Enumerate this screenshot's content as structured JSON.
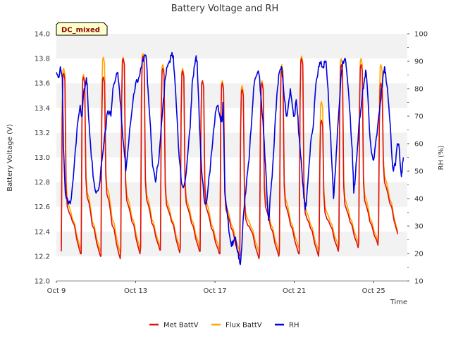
{
  "chart_data": {
    "type": "line",
    "title": "Battery Voltage and RH",
    "badge": "DC_mixed",
    "xlabel": "Time",
    "ylabel_left": "Battery Voltage (V)",
    "ylabel_right": "RH (%)",
    "x_range_days": [
      0,
      17.7
    ],
    "x_ticks": [
      {
        "day": 0,
        "label": "Oct 9"
      },
      {
        "day": 4,
        "label": "Oct 13"
      },
      {
        "day": 8,
        "label": "Oct 17"
      },
      {
        "day": 12,
        "label": "Oct 21"
      },
      {
        "day": 16,
        "label": "Oct 25"
      }
    ],
    "ylim_left": [
      12.0,
      14.0
    ],
    "yticks_left": [
      "12.0",
      "12.2",
      "12.4",
      "12.6",
      "12.8",
      "13.0",
      "13.2",
      "13.4",
      "13.6",
      "13.8",
      "14.0"
    ],
    "ylim_right": [
      10,
      100
    ],
    "yticks_right": [
      "10",
      "20",
      "30",
      "40",
      "50",
      "60",
      "70",
      "80",
      "90",
      "100"
    ],
    "grid": "horizontal bands",
    "legend_position": "bottom",
    "colors": {
      "met": "#dd1111",
      "flux": "#ffa500",
      "rh": "#0000dd",
      "band": "#f2f2f2",
      "badge_bg": "#ffffcc"
    },
    "series": [
      {
        "name": "Met BattV",
        "axis": "left",
        "daily": [
          {
            "peak": 13.68,
            "low": 12.6,
            "mid": 12.45,
            "end": 12.22
          },
          {
            "peak": 13.65,
            "low": 12.68,
            "mid": 12.42,
            "end": 12.2
          },
          {
            "peak": 13.65,
            "low": 12.7,
            "mid": 12.42,
            "end": 12.18
          },
          {
            "peak": 13.8,
            "low": 12.65,
            "mid": 12.45,
            "end": 12.22
          },
          {
            "peak": 13.82,
            "low": 12.66,
            "mid": 12.44,
            "end": 12.25
          },
          {
            "peak": 13.72,
            "low": 12.62,
            "mid": 12.45,
            "end": 12.23
          },
          {
            "peak": 13.7,
            "low": 12.63,
            "mid": 12.44,
            "end": 12.24
          },
          {
            "peak": 13.62,
            "low": 12.6,
            "mid": 12.4,
            "end": 12.22
          },
          {
            "peak": 13.6,
            "low": 12.58,
            "mid": 12.4,
            "end": 12.2
          },
          {
            "peak": 13.55,
            "low": 12.5,
            "mid": 12.38,
            "end": 12.18
          },
          {
            "peak": 13.6,
            "low": 12.6,
            "mid": 12.4,
            "end": 12.2
          },
          {
            "peak": 13.7,
            "low": 12.62,
            "mid": 12.42,
            "end": 12.22
          },
          {
            "peak": 13.8,
            "low": 12.55,
            "mid": 12.4,
            "end": 12.2
          },
          {
            "peak": 13.3,
            "low": 12.55,
            "mid": 12.42,
            "end": 12.24
          },
          {
            "peak": 13.75,
            "low": 12.62,
            "mid": 12.45,
            "end": 12.27
          },
          {
            "peak": 13.75,
            "low": 12.65,
            "mid": 12.45,
            "end": 12.29
          },
          {
            "peak": 13.6,
            "low": 12.8,
            "mid": 12.6,
            "end": 12.38
          }
        ]
      },
      {
        "name": "Flux BattV",
        "axis": "left",
        "daily": [
          {
            "peak": 13.72,
            "low": 12.65,
            "mid": 12.47,
            "end": 12.26
          },
          {
            "peak": 13.67,
            "low": 12.72,
            "mid": 12.45,
            "end": 12.24
          },
          {
            "peak": 13.81,
            "low": 12.76,
            "mid": 12.47,
            "end": 12.23
          },
          {
            "peak": 13.81,
            "low": 12.7,
            "mid": 12.48,
            "end": 12.26
          },
          {
            "peak": 13.84,
            "low": 12.7,
            "mid": 12.47,
            "end": 12.28
          },
          {
            "peak": 13.75,
            "low": 12.66,
            "mid": 12.47,
            "end": 12.27
          },
          {
            "peak": 13.72,
            "low": 12.67,
            "mid": 12.47,
            "end": 12.28
          },
          {
            "peak": 13.62,
            "low": 12.65,
            "mid": 12.43,
            "end": 12.26
          },
          {
            "peak": 13.62,
            "low": 12.62,
            "mid": 12.43,
            "end": 12.25
          },
          {
            "peak": 13.58,
            "low": 12.55,
            "mid": 12.41,
            "end": 12.23
          },
          {
            "peak": 13.62,
            "low": 12.65,
            "mid": 12.43,
            "end": 12.24
          },
          {
            "peak": 13.75,
            "low": 12.67,
            "mid": 12.45,
            "end": 12.27
          },
          {
            "peak": 13.82,
            "low": 12.6,
            "mid": 12.43,
            "end": 12.24
          },
          {
            "peak": 13.45,
            "low": 12.6,
            "mid": 12.45,
            "end": 12.28
          },
          {
            "peak": 13.8,
            "low": 12.67,
            "mid": 12.48,
            "end": 12.31
          },
          {
            "peak": 13.8,
            "low": 12.7,
            "mid": 12.48,
            "end": 12.32
          },
          {
            "peak": 13.75,
            "low": 12.85,
            "mid": 12.63,
            "end": 12.4
          }
        ]
      },
      {
        "name": "RH",
        "axis": "right",
        "points": [
          [
            0,
            86
          ],
          [
            0.1,
            84
          ],
          [
            0.2,
            88
          ],
          [
            0.3,
            84
          ],
          [
            0.35,
            60
          ],
          [
            0.45,
            42
          ],
          [
            0.6,
            38
          ],
          [
            0.75,
            40
          ],
          [
            0.9,
            52
          ],
          [
            1.05,
            66
          ],
          [
            1.2,
            74
          ],
          [
            1.3,
            70
          ],
          [
            1.4,
            80
          ],
          [
            1.5,
            83
          ],
          [
            1.55,
            82
          ],
          [
            1.62,
            70
          ],
          [
            1.72,
            60
          ],
          [
            1.85,
            48
          ],
          [
            2.0,
            42
          ],
          [
            2.15,
            44
          ],
          [
            2.3,
            54
          ],
          [
            2.45,
            64
          ],
          [
            2.6,
            72
          ],
          [
            2.75,
            70
          ],
          [
            2.85,
            80
          ],
          [
            3.0,
            84
          ],
          [
            3.1,
            86
          ],
          [
            3.15,
            82
          ],
          [
            3.25,
            74
          ],
          [
            3.35,
            62
          ],
          [
            3.45,
            55
          ],
          [
            3.5,
            50
          ],
          [
            3.6,
            57
          ],
          [
            3.75,
            68
          ],
          [
            3.9,
            78
          ],
          [
            4.0,
            82
          ],
          [
            4.15,
            84
          ],
          [
            4.3,
            88
          ],
          [
            4.4,
            90
          ],
          [
            4.5,
            92
          ],
          [
            4.55,
            90
          ],
          [
            4.62,
            80
          ],
          [
            4.75,
            66
          ],
          [
            4.85,
            52
          ],
          [
            5.0,
            46
          ],
          [
            5.12,
            52
          ],
          [
            5.25,
            62
          ],
          [
            5.4,
            76
          ],
          [
            5.5,
            84
          ],
          [
            5.6,
            88
          ],
          [
            5.7,
            90
          ],
          [
            5.8,
            92
          ],
          [
            5.9,
            92
          ],
          [
            5.95,
            86
          ],
          [
            6.05,
            74
          ],
          [
            6.15,
            60
          ],
          [
            6.3,
            46
          ],
          [
            6.45,
            45
          ],
          [
            6.6,
            54
          ],
          [
            6.75,
            66
          ],
          [
            6.85,
            82
          ],
          [
            6.95,
            88
          ],
          [
            7.05,
            92
          ],
          [
            7.1,
            90
          ],
          [
            7.15,
            80
          ],
          [
            7.25,
            62
          ],
          [
            7.35,
            48
          ],
          [
            7.5,
            38
          ],
          [
            7.6,
            40
          ],
          [
            7.7,
            48
          ],
          [
            7.85,
            58
          ],
          [
            7.95,
            66
          ],
          [
            8.05,
            72
          ],
          [
            8.15,
            74
          ],
          [
            8.25,
            70
          ],
          [
            8.35,
            68
          ],
          [
            8.4,
            75
          ],
          [
            8.45,
            62
          ],
          [
            8.5,
            42
          ],
          [
            8.6,
            36
          ],
          [
            8.7,
            28
          ],
          [
            8.8,
            24
          ],
          [
            8.9,
            23
          ],
          [
            9.0,
            26
          ],
          [
            9.1,
            22
          ],
          [
            9.2,
            18
          ],
          [
            9.28,
            16
          ],
          [
            9.35,
            22
          ],
          [
            9.45,
            35
          ],
          [
            9.55,
            42
          ],
          [
            9.65,
            50
          ],
          [
            9.75,
            58
          ],
          [
            9.85,
            68
          ],
          [
            9.95,
            80
          ],
          [
            10.05,
            84
          ],
          [
            10.15,
            86
          ],
          [
            10.25,
            84
          ],
          [
            10.35,
            74
          ],
          [
            10.45,
            64
          ],
          [
            10.55,
            52
          ],
          [
            10.65,
            38
          ],
          [
            10.7,
            32
          ],
          [
            10.75,
            36
          ],
          [
            10.85,
            46
          ],
          [
            10.95,
            56
          ],
          [
            11.05,
            70
          ],
          [
            11.15,
            80
          ],
          [
            11.25,
            86
          ],
          [
            11.35,
            88
          ],
          [
            11.42,
            84
          ],
          [
            11.5,
            76
          ],
          [
            11.6,
            70
          ],
          [
            11.7,
            74
          ],
          [
            11.8,
            80
          ],
          [
            11.9,
            74
          ],
          [
            12.0,
            70
          ],
          [
            12.1,
            76
          ],
          [
            12.15,
            72
          ],
          [
            12.25,
            62
          ],
          [
            12.35,
            54
          ],
          [
            12.45,
            44
          ],
          [
            12.55,
            36
          ],
          [
            12.62,
            40
          ],
          [
            12.72,
            50
          ],
          [
            12.82,
            60
          ],
          [
            12.95,
            66
          ],
          [
            13.05,
            78
          ],
          [
            13.15,
            84
          ],
          [
            13.25,
            88
          ],
          [
            13.35,
            90
          ],
          [
            13.45,
            88
          ],
          [
            13.55,
            90
          ],
          [
            13.62,
            88
          ],
          [
            13.7,
            80
          ],
          [
            13.8,
            66
          ],
          [
            13.9,
            52
          ],
          [
            13.98,
            40
          ],
          [
            14.05,
            48
          ],
          [
            14.15,
            60
          ],
          [
            14.25,
            72
          ],
          [
            14.35,
            84
          ],
          [
            14.45,
            90
          ],
          [
            14.55,
            91
          ],
          [
            14.62,
            88
          ],
          [
            14.72,
            80
          ],
          [
            14.82,
            70
          ],
          [
            14.92,
            58
          ],
          [
            15.0,
            42
          ],
          [
            15.05,
            45
          ],
          [
            15.15,
            55
          ],
          [
            15.25,
            66
          ],
          [
            15.35,
            72
          ],
          [
            15.45,
            80
          ],
          [
            15.55,
            84
          ],
          [
            15.62,
            86
          ],
          [
            15.72,
            76
          ],
          [
            15.82,
            62
          ],
          [
            15.92,
            56
          ],
          [
            16.0,
            54
          ],
          [
            16.1,
            60
          ],
          [
            16.2,
            66
          ],
          [
            16.3,
            72
          ],
          [
            16.4,
            80
          ],
          [
            16.5,
            86
          ],
          [
            16.55,
            88
          ],
          [
            16.6,
            86
          ],
          [
            16.7,
            80
          ],
          [
            16.8,
            70
          ],
          [
            16.9,
            58
          ],
          [
            17.0,
            50
          ],
          [
            17.1,
            52
          ],
          [
            17.2,
            60
          ],
          [
            17.3,
            58
          ],
          [
            17.4,
            48
          ],
          [
            17.45,
            52
          ],
          [
            17.5,
            55
          ]
        ]
      }
    ]
  }
}
